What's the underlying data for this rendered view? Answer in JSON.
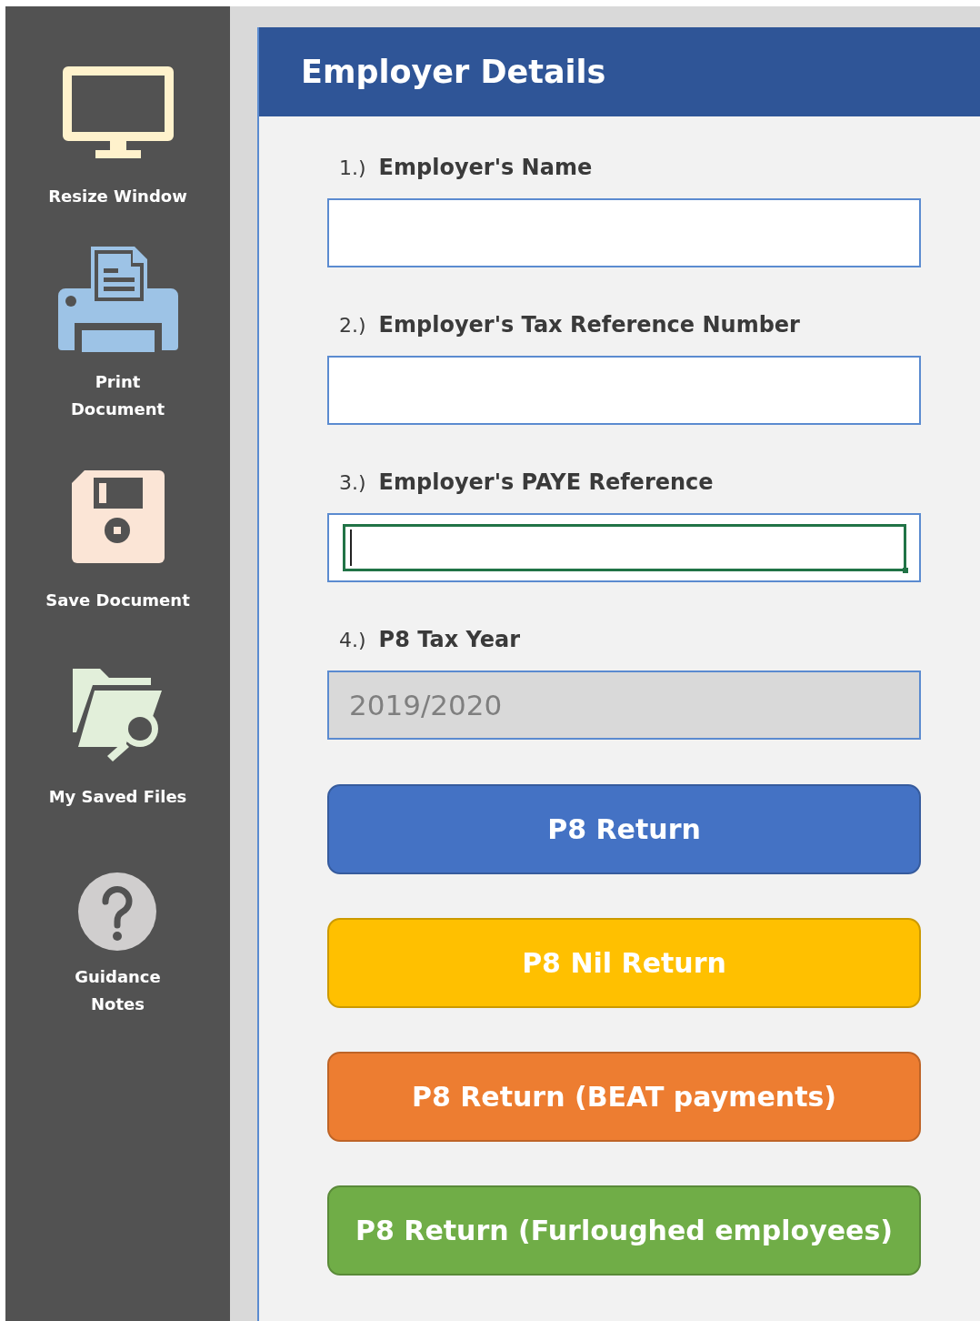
{
  "sidebar": {
    "items": [
      {
        "kind": "monitor",
        "label": "Resize Window"
      },
      {
        "kind": "printer",
        "label": "Print\nDocument"
      },
      {
        "kind": "floppy",
        "label": "Save Document"
      },
      {
        "kind": "folder-search",
        "label": "My Saved Files"
      },
      {
        "kind": "help",
        "label": "Guidance\nNotes"
      }
    ]
  },
  "panel": {
    "title": "Employer Details",
    "fields": [
      {
        "number": "1.)",
        "label": "Employer's Name",
        "focused": false,
        "disabled": false
      },
      {
        "number": "2.)",
        "label": "Employer's Tax Reference Number",
        "focused": false,
        "disabled": false
      },
      {
        "number": "3.)",
        "label": "Employer's PAYE Reference",
        "focused": true,
        "disabled": false
      },
      {
        "number": "4.)",
        "label": "P8 Tax Year",
        "value": "2019/2020",
        "focused": false,
        "disabled": true
      }
    ],
    "buttons": [
      {
        "label": "P8 Return",
        "color": "#4472c4"
      },
      {
        "label": "P8 Nil Return",
        "color": "#ffc000"
      },
      {
        "label": "P8 Return (BEAT payments)",
        "color": "#ed7d31"
      },
      {
        "label": "P8 Return (Furloughed employees)",
        "color": "#70ad47"
      }
    ]
  }
}
